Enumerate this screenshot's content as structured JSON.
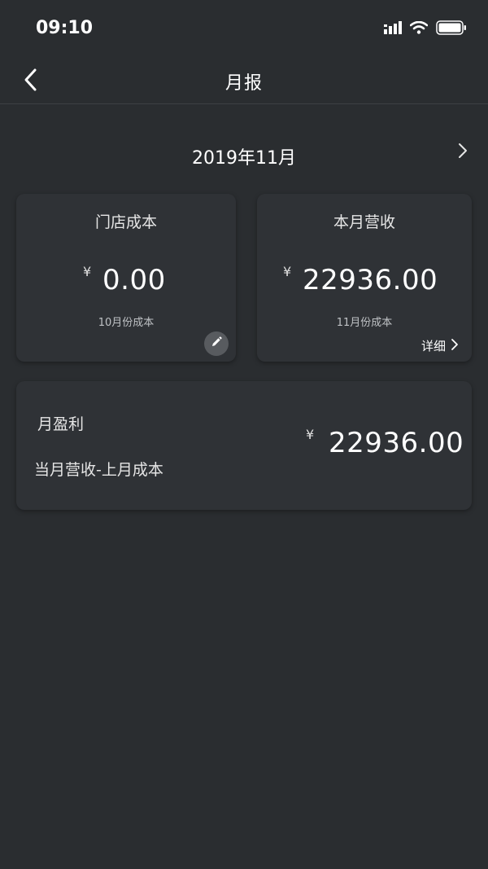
{
  "status_bar": {
    "time": "09:10",
    "icons": [
      "signal-icon",
      "wifi-icon",
      "battery-icon"
    ]
  },
  "nav": {
    "title": "月报",
    "back_icon": "chevron-left-icon"
  },
  "month_selector": {
    "label": "2019年11月",
    "next_icon": "chevron-right-icon"
  },
  "store_cost_card": {
    "title": "门店成本",
    "currency": "¥",
    "amount": "0.00",
    "subtitle": "10月份成本",
    "edit_icon": "pencil-icon"
  },
  "revenue_card": {
    "title": "本月营收",
    "currency": "¥",
    "amount": "22936.00",
    "subtitle": "11月份成本",
    "detail_label": "详细"
  },
  "profit_card": {
    "title": "月盈利",
    "formula": "当月营收-上月成本",
    "currency": "¥",
    "amount": "22936.00"
  },
  "colors": {
    "background": "#2a2d30",
    "card": "#2f3236",
    "text": "#ffffff",
    "muted_text": "#bfc2c5"
  }
}
